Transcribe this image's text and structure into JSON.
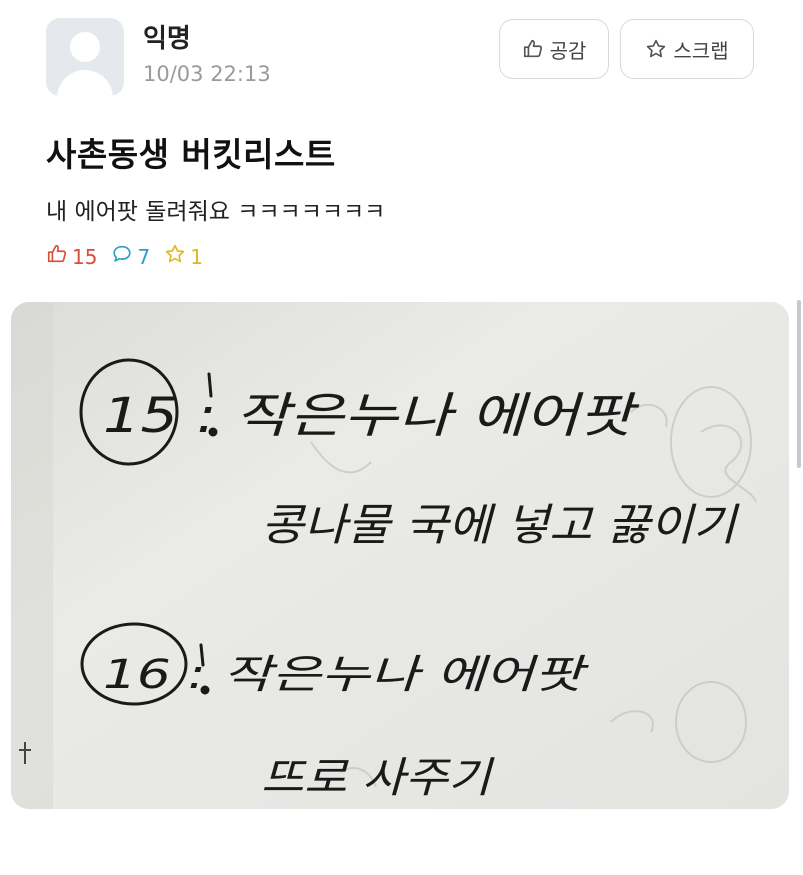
{
  "post": {
    "author": "익명",
    "time": "10/03 22:13",
    "title": "사촌동생 버킷리스트",
    "body": "내 에어팟 돌려줘요 ㅋㅋㅋㅋㅋㅋㅋ"
  },
  "actions": {
    "like_label": "공감",
    "scrap_label": "스크랩"
  },
  "stats": {
    "likes": "15",
    "comments": "7",
    "scraps": "1"
  },
  "colors": {
    "like": "#d5503b",
    "comment": "#2b9fc6",
    "scrap": "#e2b620"
  },
  "photo": {
    "lines": [
      "15 : 작은누나 에어팟",
      "콩나물 국에 넣고 끓이기",
      "16 : 작은누나 에어팟",
      "뜨로 사주기"
    ]
  }
}
